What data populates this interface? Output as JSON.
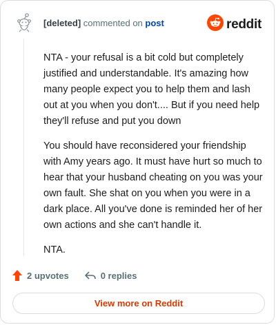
{
  "header": {
    "author": "[deleted]",
    "action_text": "commented on",
    "post_link": "post",
    "brand": "reddit"
  },
  "comment": {
    "paragraphs": [
      "NTA - your refusal is a bit cold but completely justified and understandable. It's amazing how many people expect you to help them and lash out at you when you don't.... But if you need help they'll refuse and put you down",
      "You should have reconsidered your friendship with Amy years ago. It must have hurt so much to hear that your husband cheating on you was your own fault. She shat on you when you were in a dark place. All you've done is reminded her of her own actions and she can't handle it.",
      "NTA."
    ]
  },
  "actions": {
    "upvotes": "2 upvotes",
    "replies": "0 replies"
  },
  "footer": {
    "view_more": "View more on Reddit"
  },
  "colors": {
    "upvote": "#ff4500",
    "brand": "#ff4500",
    "link": "#0045ac",
    "view_more": "#d93900"
  },
  "icons": {
    "avatar": "snoo-avatar-icon",
    "brand": "reddit-logo-icon",
    "upvote": "upvote-arrow-icon",
    "reply": "reply-arrow-icon"
  }
}
